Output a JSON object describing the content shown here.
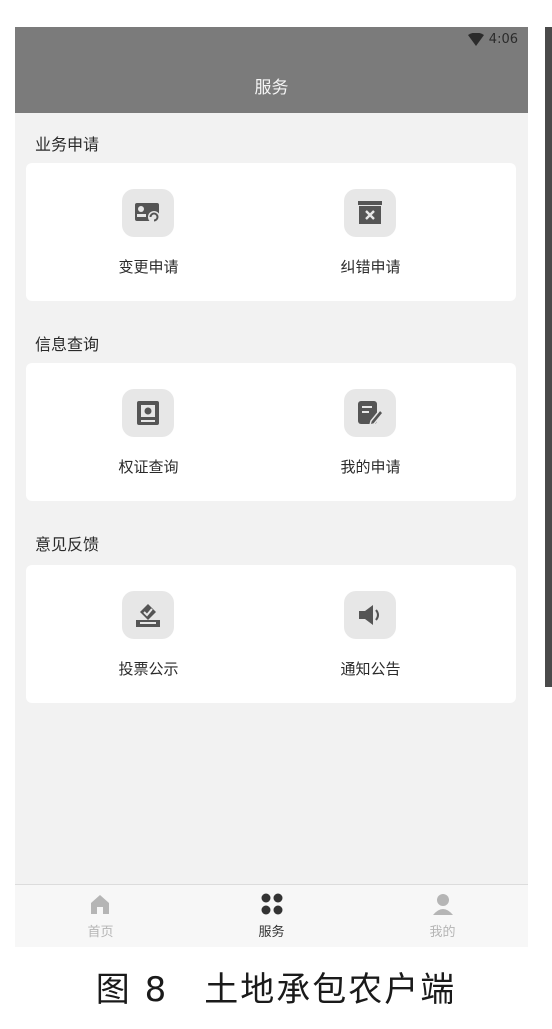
{
  "status_bar": {
    "time": "4:06",
    "wifi_icon": "wifi-icon"
  },
  "header": {
    "title": "服务"
  },
  "sections": [
    {
      "title": "业务申请",
      "items": [
        {
          "label": "变更申请",
          "icon": "change-request-icon"
        },
        {
          "label": "纠错申请",
          "icon": "correction-request-icon"
        }
      ]
    },
    {
      "title": "信息查询",
      "items": [
        {
          "label": "权证查询",
          "icon": "certificate-icon"
        },
        {
          "label": "我的申请",
          "icon": "edit-document-icon"
        }
      ]
    },
    {
      "title": "意见反馈",
      "items": [
        {
          "label": "投票公示",
          "icon": "vote-icon"
        },
        {
          "label": "通知公告",
          "icon": "speaker-icon"
        }
      ]
    }
  ],
  "tabbar": {
    "items": [
      {
        "label": "首页",
        "icon": "home-icon",
        "active": false
      },
      {
        "label": "服务",
        "icon": "services-icon",
        "active": true
      },
      {
        "label": "我的",
        "icon": "profile-icon",
        "active": false
      }
    ]
  },
  "caption": "图 8　土地承包农户端",
  "colors": {
    "header_bg": "#7b7b7b",
    "page_bg": "#f2f2f2",
    "card_bg": "#ffffff",
    "icon_bg": "#e7e7e7",
    "icon_fg": "#555555"
  }
}
